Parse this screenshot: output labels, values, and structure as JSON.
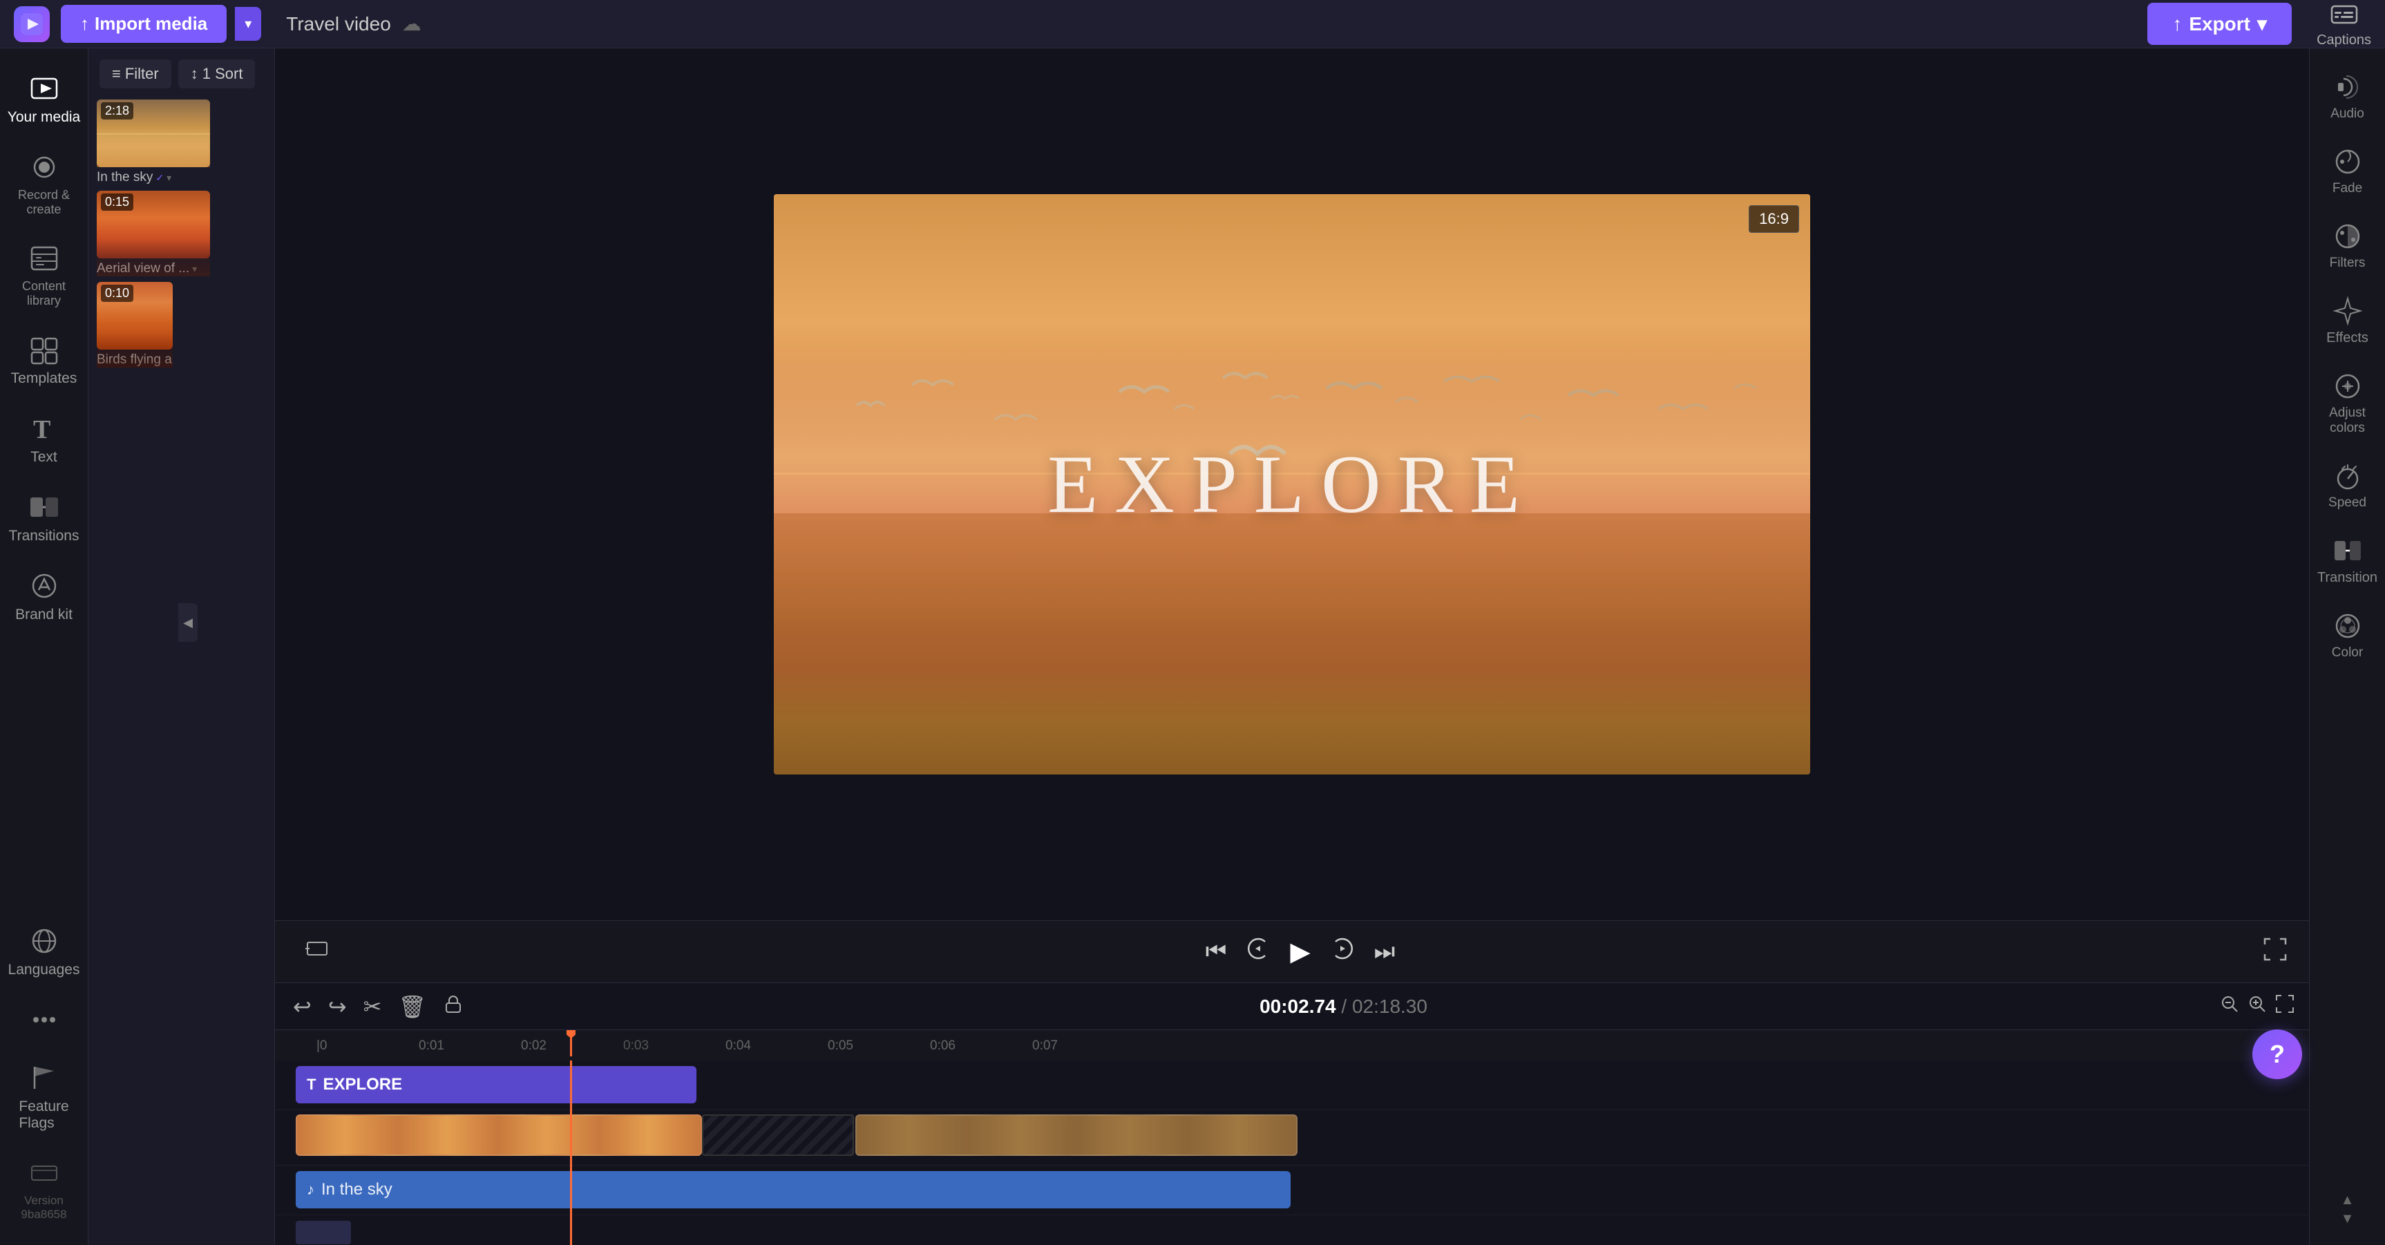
{
  "topbar": {
    "logo_icon": "▶",
    "import_label": "Import media",
    "import_arrow": "▾",
    "project_name": "Travel video",
    "cloud_icon": "☁",
    "export_label": "Export",
    "export_icon": "↑",
    "captions_label": "Captions"
  },
  "left_sidebar": {
    "items": [
      {
        "id": "your-media",
        "label": "Your media",
        "icon": "media"
      },
      {
        "id": "record-create",
        "label": "Record &\ncreate",
        "icon": "record"
      },
      {
        "id": "content-library",
        "label": "Content library",
        "icon": "library"
      },
      {
        "id": "templates",
        "label": "Templates",
        "icon": "templates"
      },
      {
        "id": "text",
        "label": "Text",
        "icon": "text"
      },
      {
        "id": "transitions",
        "label": "Transitions",
        "icon": "transitions"
      },
      {
        "id": "brand-kit",
        "label": "Brand kit",
        "icon": "brand"
      }
    ],
    "bottom_items": [
      {
        "id": "languages",
        "label": "Languages",
        "icon": "languages"
      },
      {
        "id": "more",
        "label": "...",
        "icon": "more"
      },
      {
        "id": "feature-flags",
        "label": "Feature Flags",
        "icon": "flags"
      },
      {
        "id": "version",
        "label": "Version\n9ba8658",
        "icon": "version"
      }
    ]
  },
  "media_panel": {
    "filter_label": "Filter",
    "sort_label": "1 Sort",
    "items": [
      {
        "id": "sky",
        "duration": "2:18",
        "label": "In the sky",
        "has_check": true
      },
      {
        "id": "aerial",
        "duration": "0:15",
        "label": "Aerial view of ...",
        "has_check": false
      },
      {
        "id": "birds",
        "duration": "0:10",
        "label": "Birds flying ab...",
        "has_check": false
      }
    ]
  },
  "preview": {
    "explore_text": "EXPLORE",
    "aspect_ratio": "16:9"
  },
  "playback": {
    "skip_back_icon": "⏮",
    "rewind_icon": "↺",
    "play_icon": "▶",
    "fast_forward_icon": "↻",
    "skip_forward_icon": "⏭",
    "fit_icon": "⊡",
    "fullscreen_icon": "⛶"
  },
  "timeline": {
    "current_time": "00:02.74",
    "total_time": "02:18.30",
    "undo_icon": "↩",
    "redo_icon": "↪",
    "cut_icon": "✂",
    "delete_icon": "🗑",
    "lock_icon": "🔒",
    "zoom_out_icon": "−",
    "zoom_in_icon": "+",
    "fit_icon": "⤢",
    "ruler_marks": [
      "0",
      "0:01",
      "0:02",
      "0:03",
      "0:04",
      "0:05",
      "0:06",
      "0:07"
    ],
    "tracks": [
      {
        "id": "text-track",
        "type": "text",
        "label": "EXPLORE",
        "icon": "T"
      },
      {
        "id": "video-track",
        "type": "video",
        "label": ""
      },
      {
        "id": "audio-track",
        "type": "audio",
        "label": "In the sky",
        "icon": "♪"
      }
    ]
  },
  "right_sidebar": {
    "items": [
      {
        "id": "audio",
        "label": "Audio",
        "icon": "audio"
      },
      {
        "id": "fade",
        "label": "Fade",
        "icon": "fade"
      },
      {
        "id": "filters",
        "label": "Filters",
        "icon": "filters"
      },
      {
        "id": "effects",
        "label": "Effects",
        "icon": "effects"
      },
      {
        "id": "adjust-colors",
        "label": "Adjust colors",
        "icon": "adjust"
      },
      {
        "id": "speed",
        "label": "Speed",
        "icon": "speed"
      },
      {
        "id": "transition",
        "label": "Transition",
        "icon": "transition"
      },
      {
        "id": "color",
        "label": "Color",
        "icon": "color"
      }
    ]
  }
}
